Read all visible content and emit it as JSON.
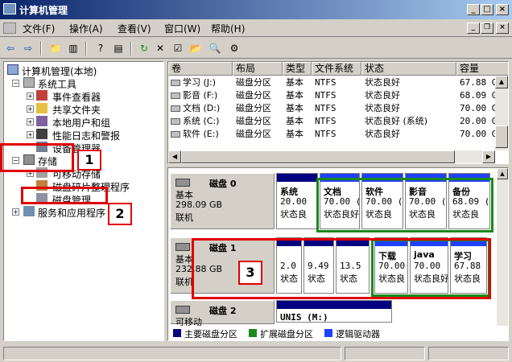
{
  "window": {
    "title": "计算机管理"
  },
  "menu": [
    "文件(F)",
    "操作(A)",
    "查看(V)",
    "窗口(W)",
    "帮助(H)"
  ],
  "tree": {
    "root": "计算机管理(本地)",
    "system_tools": "系统工具",
    "event_viewer": "事件查看器",
    "shared_folders": "共享文件夹",
    "local_users": "本地用户和组",
    "perf_logs": "性能日志和警报",
    "device_manager": "设备管理器",
    "storage": "存储",
    "removable": "可移动存储",
    "defrag": "磁盘碎片整理程序",
    "disk_mgmt": "磁盘管理",
    "services": "服务和应用程序"
  },
  "volumes": {
    "columns": [
      "卷",
      "布局",
      "类型",
      "文件系统",
      "状态",
      "容量"
    ],
    "rows": [
      [
        "学习 (J:)",
        "磁盘分区",
        "基本",
        "NTFS",
        "状态良好",
        "67.88 G"
      ],
      [
        "影音 (F:)",
        "磁盘分区",
        "基本",
        "NTFS",
        "状态良好",
        "68.09 G"
      ],
      [
        "文档 (D:)",
        "磁盘分区",
        "基本",
        "NTFS",
        "状态良好",
        "70.00 G"
      ],
      [
        "系统 (C:)",
        "磁盘分区",
        "基本",
        "NTFS",
        "状态良好 (系统)",
        "20.00 G"
      ],
      [
        "软件 (E:)",
        "磁盘分区",
        "基本",
        "NTFS",
        "状态良好",
        "70.00 G"
      ]
    ]
  },
  "disks": [
    {
      "name": "磁盘 0",
      "type": "基本",
      "size": "298.09 GB",
      "status": "联机",
      "partitions": [
        {
          "name": "系统",
          "size": "20.00",
          "status": "状态良"
        },
        {
          "name": "文档",
          "size": "70.00 (",
          "status": "状态良好"
        },
        {
          "name": "软件",
          "size": "70.00 (",
          "status": "状态良"
        },
        {
          "name": "影音",
          "size": "70.00 (",
          "status": "状态良"
        },
        {
          "name": "备份",
          "size": "68.09 (",
          "status": "状态良"
        }
      ]
    },
    {
      "name": "磁盘 1",
      "type": "基本",
      "size": "232.88 GB",
      "status": "联机",
      "partitions": [
        {
          "name": "",
          "size": "2.0",
          "status": "状态"
        },
        {
          "name": "",
          "size": "9.49",
          "status": "状态"
        },
        {
          "name": "",
          "size": "13.5",
          "status": "状态"
        },
        {
          "name": "下载",
          "size": "70.00",
          "status": "状态良"
        },
        {
          "name": "java",
          "size": "70.00",
          "status": "状态良好"
        },
        {
          "name": "学习",
          "size": "67.88",
          "status": "状态良"
        }
      ]
    },
    {
      "name": "磁盘 2",
      "type": "可移动",
      "size": "",
      "status": "",
      "partitions": [
        {
          "name": "UNIS (M:)",
          "size": "",
          "status": ""
        }
      ]
    }
  ],
  "legend": [
    "主要磁盘分区",
    "扩展磁盘分区",
    "逻辑驱动器"
  ],
  "callouts": [
    "1",
    "2",
    "3"
  ],
  "colors": {
    "primary": "#000080",
    "extended": "#1a8a1a",
    "logical": "#2040ff",
    "annotation": "#e00000"
  }
}
